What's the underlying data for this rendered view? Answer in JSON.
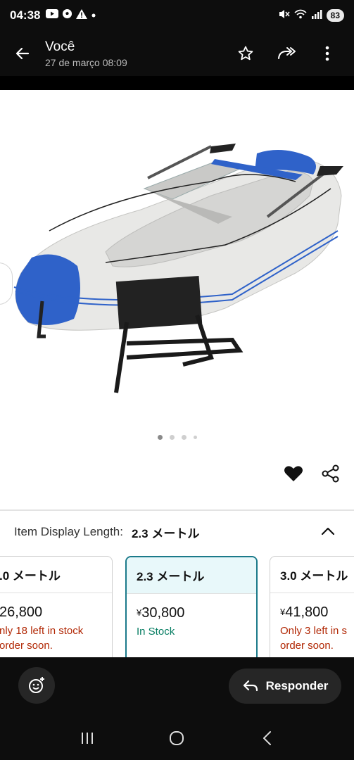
{
  "status_bar": {
    "time": "04:38",
    "battery": "83",
    "notification_icons": [
      "youtube-icon",
      "soccer-icon",
      "alert-icon",
      "dot-icon"
    ],
    "system_icons": [
      "mute-icon",
      "wifi-icon",
      "signal-icon",
      "battery-icon"
    ]
  },
  "app_bar": {
    "title": "Você",
    "subtitle": "27 de março 08:09",
    "actions": [
      "star-icon",
      "forward-icon",
      "more-vert-icon"
    ]
  },
  "product": {
    "carousel": {
      "count": 4,
      "active_index": 0
    },
    "variant": {
      "label": "Item Display Length:",
      "value": "2.3 メートル"
    },
    "cards": [
      {
        "name": ".0 メートル",
        "price_symbol": "",
        "price": "26,800",
        "stock_line1": "nly 18 left in stock",
        "stock_line2": "order soon.",
        "status": "low",
        "selected": false
      },
      {
        "name": "2.3 メートル",
        "price_symbol": "¥",
        "price": "30,800",
        "stock_line1": "In Stock",
        "stock_line2": "",
        "status": "in_stock",
        "selected": true
      },
      {
        "name": "3.0 メートル",
        "price_symbol": "¥",
        "price": "41,800",
        "stock_line1": "Only 3 left in s",
        "stock_line2": "order soon.",
        "status": "low",
        "selected": false
      }
    ]
  },
  "reply_bar": {
    "reply_label": "Responder"
  },
  "colors": {
    "accent": "#1b7a8a",
    "stock_red": "#b12704",
    "stock_green": "#067d62",
    "boat_blue": "#2f62c9"
  }
}
